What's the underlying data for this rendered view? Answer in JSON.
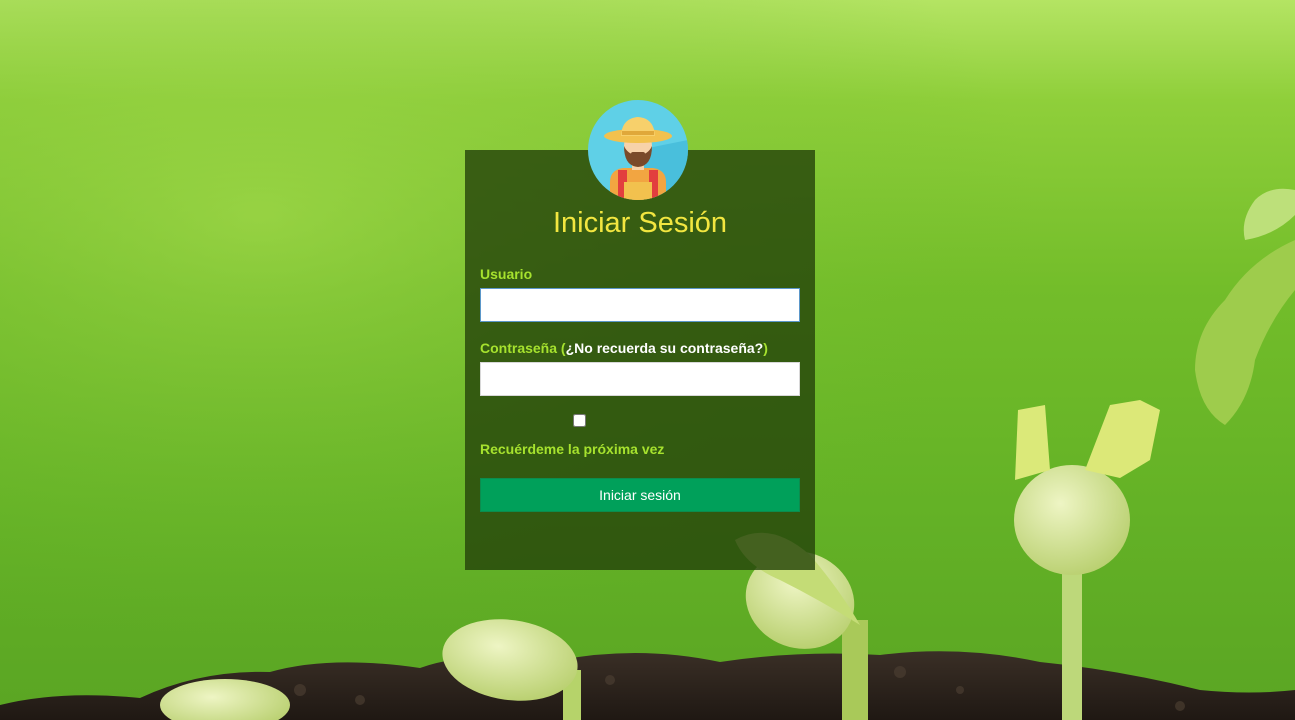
{
  "login": {
    "title": "Iniciar Sesión",
    "username_label": "Usuario",
    "username_value": "",
    "password_label": "Contraseña",
    "password_open_paren": " (",
    "forgot_link": "¿No recuerda su contraseña?",
    "password_close_paren": ")",
    "password_value": "",
    "remember_label": "Recuérdeme la próxima vez",
    "submit_label": "Iniciar sesión"
  },
  "colors": {
    "title": "#f2e640",
    "label": "#a6e22e",
    "button": "#00a05a",
    "card": "rgba(36,66,10,0.80)"
  },
  "icons": {
    "avatar": "farmer-avatar-icon"
  }
}
